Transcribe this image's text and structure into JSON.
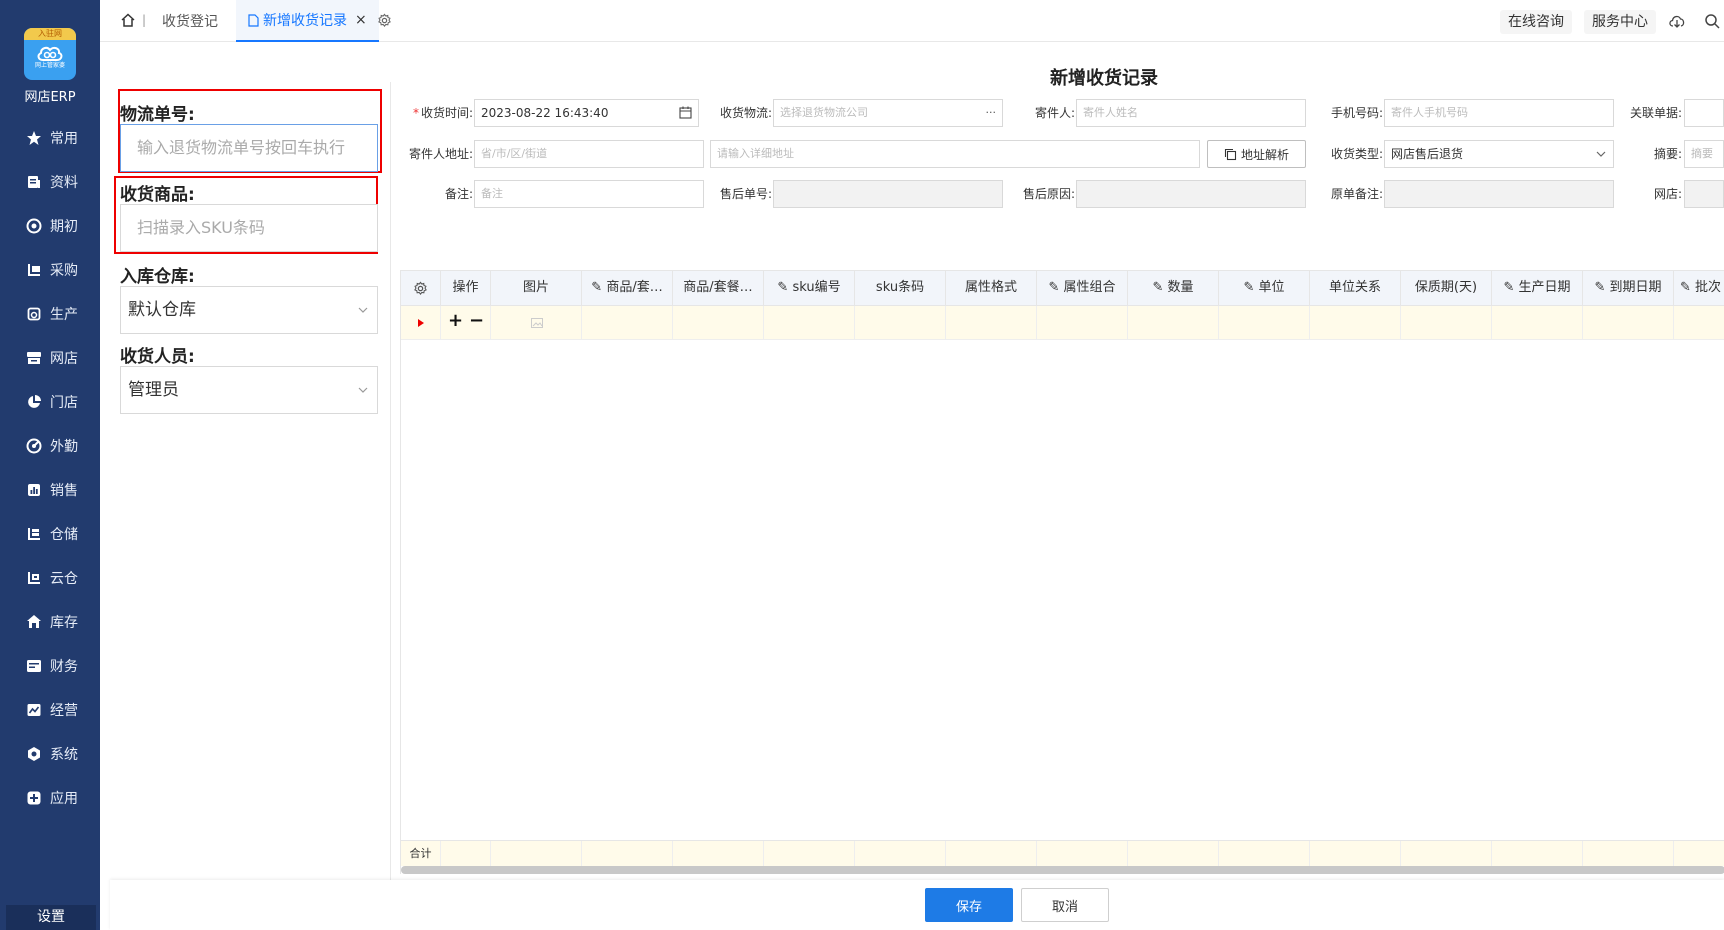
{
  "sidebar": {
    "logo_badge": "入驻网",
    "logo_sub": "网上管家婆",
    "app_name": "网店ERP",
    "items": [
      {
        "label": "常用",
        "icon": "star-icon"
      },
      {
        "label": "资料",
        "icon": "document-icon"
      },
      {
        "label": "期初",
        "icon": "target-icon"
      },
      {
        "label": "采购",
        "icon": "purchase-icon"
      },
      {
        "label": "生产",
        "icon": "production-icon"
      },
      {
        "label": "网店",
        "icon": "store-icon"
      },
      {
        "label": "门店",
        "icon": "pie-icon"
      },
      {
        "label": "外勤",
        "icon": "field-icon"
      },
      {
        "label": "销售",
        "icon": "sales-icon"
      },
      {
        "label": "仓储",
        "icon": "warehouse-icon"
      },
      {
        "label": "云仓",
        "icon": "cloud-warehouse-icon"
      },
      {
        "label": "库存",
        "icon": "inventory-icon"
      },
      {
        "label": "财务",
        "icon": "finance-icon"
      },
      {
        "label": "经营",
        "icon": "operation-icon"
      },
      {
        "label": "系统",
        "icon": "system-icon"
      },
      {
        "label": "应用",
        "icon": "apps-icon"
      }
    ],
    "settings_label": "设置"
  },
  "topbar": {
    "tabs": [
      {
        "label": "收货登记"
      },
      {
        "label": "新增收货记录",
        "close": "×"
      }
    ],
    "online_consult": "在线咨询",
    "service_center": "服务中心"
  },
  "page": {
    "title": "新增收货记录"
  },
  "scan_panel": {
    "tracking_label": "物流单号:",
    "tracking_placeholder": "输入退货物流单号按回车执行",
    "goods_label": "收货商品:",
    "goods_placeholder": "扫描录入SKU条码",
    "warehouse_label": "入库仓库:",
    "warehouse_value": "默认仓库",
    "staff_label": "收货人员:",
    "staff_value": "管理员"
  },
  "form": {
    "receive_time_label": "收货时间:",
    "receive_time_value": "2023-08-22 16:43:40",
    "logistics_label": "收货物流:",
    "logistics_placeholder": "选择退货物流公司",
    "logistics_more": "···",
    "sender_label": "寄件人:",
    "sender_placeholder": "寄件人姓名",
    "phone_label": "手机号码:",
    "phone_placeholder": "寄件人手机号码",
    "related_label": "关联单据:",
    "address_label": "寄件人地址:",
    "region_placeholder": "省/市/区/街道",
    "detail_placeholder": "请输入详细地址",
    "parse_button": "地址解析",
    "type_label": "收货类型:",
    "type_value": "网店售后退货",
    "summary_label": "摘要:",
    "summary_placeholder": "摘要",
    "remark_label": "备注:",
    "remark_placeholder": "备注",
    "after_sale_no_label": "售后单号:",
    "after_sale_reason_label": "售后原因:",
    "orig_remark_label": "原单备注:",
    "shop_label": "网店:"
  },
  "grid": {
    "columns": [
      "操作",
      "图片",
      "商品/套…",
      "商品/套餐…",
      "sku编号",
      "sku条码",
      "属性格式",
      "属性组合",
      "数量",
      "单位",
      "单位关系",
      "保质期(天)",
      "生产日期",
      "到期日期",
      "批次"
    ],
    "row_add": "+",
    "row_remove": "−",
    "total_label": "合计"
  },
  "actions": {
    "save": "保存",
    "cancel": "取消"
  },
  "colors": {
    "sidebar_bg": "#223b6e",
    "accent": "#1677ff",
    "save_button": "#1e7be6",
    "highlight_border": "#e00000",
    "row_bg": "#fffbea"
  }
}
